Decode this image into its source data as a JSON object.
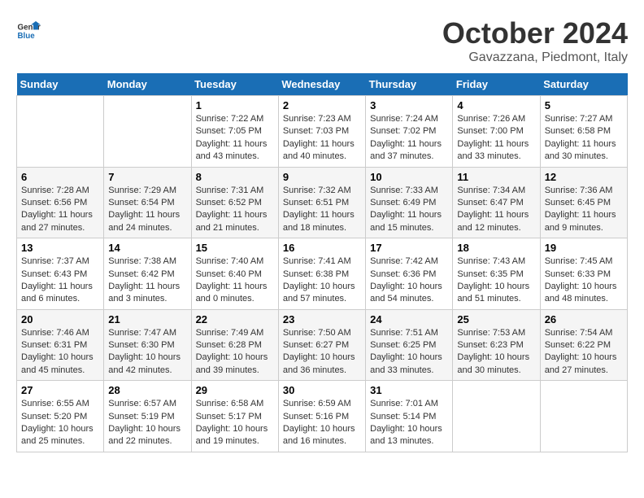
{
  "header": {
    "logo_line1": "General",
    "logo_line2": "Blue",
    "month": "October 2024",
    "location": "Gavazzana, Piedmont, Italy"
  },
  "weekdays": [
    "Sunday",
    "Monday",
    "Tuesday",
    "Wednesday",
    "Thursday",
    "Friday",
    "Saturday"
  ],
  "weeks": [
    [
      {
        "day": "",
        "info": ""
      },
      {
        "day": "",
        "info": ""
      },
      {
        "day": "1",
        "info": "Sunrise: 7:22 AM\nSunset: 7:05 PM\nDaylight: 11 hours and 43 minutes."
      },
      {
        "day": "2",
        "info": "Sunrise: 7:23 AM\nSunset: 7:03 PM\nDaylight: 11 hours and 40 minutes."
      },
      {
        "day": "3",
        "info": "Sunrise: 7:24 AM\nSunset: 7:02 PM\nDaylight: 11 hours and 37 minutes."
      },
      {
        "day": "4",
        "info": "Sunrise: 7:26 AM\nSunset: 7:00 PM\nDaylight: 11 hours and 33 minutes."
      },
      {
        "day": "5",
        "info": "Sunrise: 7:27 AM\nSunset: 6:58 PM\nDaylight: 11 hours and 30 minutes."
      }
    ],
    [
      {
        "day": "6",
        "info": "Sunrise: 7:28 AM\nSunset: 6:56 PM\nDaylight: 11 hours and 27 minutes."
      },
      {
        "day": "7",
        "info": "Sunrise: 7:29 AM\nSunset: 6:54 PM\nDaylight: 11 hours and 24 minutes."
      },
      {
        "day": "8",
        "info": "Sunrise: 7:31 AM\nSunset: 6:52 PM\nDaylight: 11 hours and 21 minutes."
      },
      {
        "day": "9",
        "info": "Sunrise: 7:32 AM\nSunset: 6:51 PM\nDaylight: 11 hours and 18 minutes."
      },
      {
        "day": "10",
        "info": "Sunrise: 7:33 AM\nSunset: 6:49 PM\nDaylight: 11 hours and 15 minutes."
      },
      {
        "day": "11",
        "info": "Sunrise: 7:34 AM\nSunset: 6:47 PM\nDaylight: 11 hours and 12 minutes."
      },
      {
        "day": "12",
        "info": "Sunrise: 7:36 AM\nSunset: 6:45 PM\nDaylight: 11 hours and 9 minutes."
      }
    ],
    [
      {
        "day": "13",
        "info": "Sunrise: 7:37 AM\nSunset: 6:43 PM\nDaylight: 11 hours and 6 minutes."
      },
      {
        "day": "14",
        "info": "Sunrise: 7:38 AM\nSunset: 6:42 PM\nDaylight: 11 hours and 3 minutes."
      },
      {
        "day": "15",
        "info": "Sunrise: 7:40 AM\nSunset: 6:40 PM\nDaylight: 11 hours and 0 minutes."
      },
      {
        "day": "16",
        "info": "Sunrise: 7:41 AM\nSunset: 6:38 PM\nDaylight: 10 hours and 57 minutes."
      },
      {
        "day": "17",
        "info": "Sunrise: 7:42 AM\nSunset: 6:36 PM\nDaylight: 10 hours and 54 minutes."
      },
      {
        "day": "18",
        "info": "Sunrise: 7:43 AM\nSunset: 6:35 PM\nDaylight: 10 hours and 51 minutes."
      },
      {
        "day": "19",
        "info": "Sunrise: 7:45 AM\nSunset: 6:33 PM\nDaylight: 10 hours and 48 minutes."
      }
    ],
    [
      {
        "day": "20",
        "info": "Sunrise: 7:46 AM\nSunset: 6:31 PM\nDaylight: 10 hours and 45 minutes."
      },
      {
        "day": "21",
        "info": "Sunrise: 7:47 AM\nSunset: 6:30 PM\nDaylight: 10 hours and 42 minutes."
      },
      {
        "day": "22",
        "info": "Sunrise: 7:49 AM\nSunset: 6:28 PM\nDaylight: 10 hours and 39 minutes."
      },
      {
        "day": "23",
        "info": "Sunrise: 7:50 AM\nSunset: 6:27 PM\nDaylight: 10 hours and 36 minutes."
      },
      {
        "day": "24",
        "info": "Sunrise: 7:51 AM\nSunset: 6:25 PM\nDaylight: 10 hours and 33 minutes."
      },
      {
        "day": "25",
        "info": "Sunrise: 7:53 AM\nSunset: 6:23 PM\nDaylight: 10 hours and 30 minutes."
      },
      {
        "day": "26",
        "info": "Sunrise: 7:54 AM\nSunset: 6:22 PM\nDaylight: 10 hours and 27 minutes."
      }
    ],
    [
      {
        "day": "27",
        "info": "Sunrise: 6:55 AM\nSunset: 5:20 PM\nDaylight: 10 hours and 25 minutes."
      },
      {
        "day": "28",
        "info": "Sunrise: 6:57 AM\nSunset: 5:19 PM\nDaylight: 10 hours and 22 minutes."
      },
      {
        "day": "29",
        "info": "Sunrise: 6:58 AM\nSunset: 5:17 PM\nDaylight: 10 hours and 19 minutes."
      },
      {
        "day": "30",
        "info": "Sunrise: 6:59 AM\nSunset: 5:16 PM\nDaylight: 10 hours and 16 minutes."
      },
      {
        "day": "31",
        "info": "Sunrise: 7:01 AM\nSunset: 5:14 PM\nDaylight: 10 hours and 13 minutes."
      },
      {
        "day": "",
        "info": ""
      },
      {
        "day": "",
        "info": ""
      }
    ]
  ]
}
